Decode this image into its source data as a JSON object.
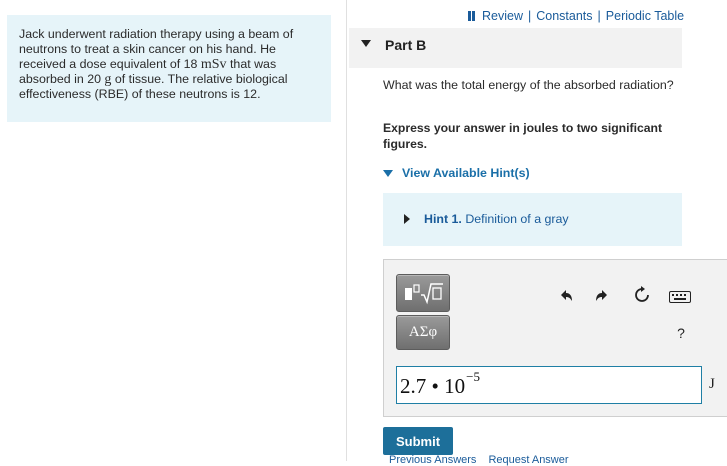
{
  "problem": {
    "text_before": "Jack underwent radiation therapy using a beam of neutrons to treat a skin cancer on his hand. He received a dose equivalent of 18 ",
    "dose_unit": "mSv",
    "text_middle": "  that was absorbed in 20 ",
    "mass_unit": "g",
    "text_after": " of tissue. The relative biological effectiveness (RBE) of these neutrons is 12."
  },
  "toplinks": {
    "review": "Review",
    "sep1": "|",
    "constants": "Constants",
    "sep2": "|",
    "periodic_table": "Periodic Table"
  },
  "part": {
    "title": "Part B"
  },
  "question": "What was the total energy of the absorbed radiation?",
  "instruction": "Express your answer in joules to two significant figures.",
  "hints": {
    "toggle_label": "View Available Hint(s)",
    "hint1_label": "Hint 1.",
    "hint1_text": " Definition of a gray"
  },
  "toolbar": {
    "greek_label": "ΑΣφ",
    "help_label": "?"
  },
  "answer": {
    "mantissa": "2.7",
    "dot": "•",
    "base": "10",
    "exponent": "−5",
    "unit": "J"
  },
  "buttons": {
    "submit": "Submit",
    "previous_answers": "Previous Answers",
    "request_answer": "Request Answer"
  },
  "colors": {
    "accent": "#1d6f9a",
    "link": "#1a5b9a",
    "info_bg": "#e6f4f9"
  }
}
